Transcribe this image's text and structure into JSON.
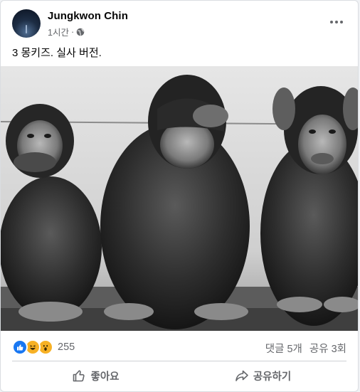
{
  "post": {
    "author": "Jungkwon Chin",
    "time": "1시간",
    "privacy_icon": "globe-icon",
    "text": "3 몽키즈. 실사 버전."
  },
  "stats": {
    "reaction_icons": [
      "like-icon",
      "haha-icon",
      "wow-icon"
    ],
    "reaction_count": "255",
    "comments": "댓글 5개",
    "shares": "공유 3회"
  },
  "actions": {
    "like_label": "좋아요",
    "share_label": "공유하기"
  },
  "colors": {
    "accent": "#1877f2",
    "secondary_text": "#65676b",
    "reaction_yellow": "#f7b125"
  }
}
